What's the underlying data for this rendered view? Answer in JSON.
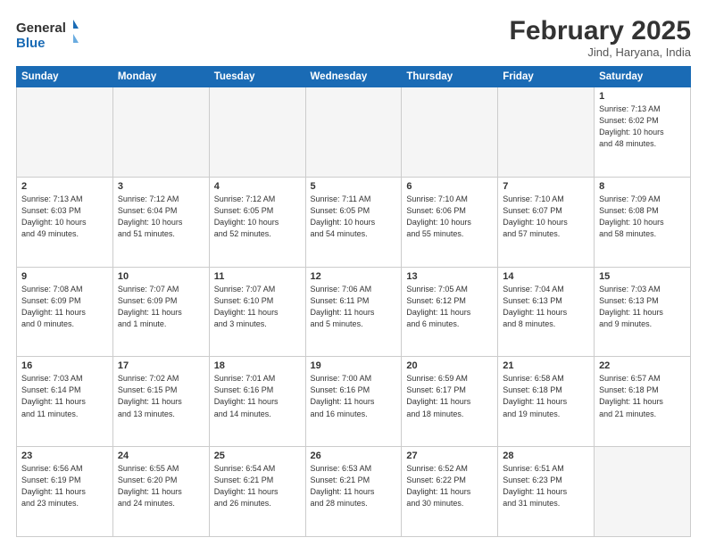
{
  "header": {
    "logo_general": "General",
    "logo_blue": "Blue",
    "month_title": "February 2025",
    "location": "Jind, Haryana, India"
  },
  "days_of_week": [
    "Sunday",
    "Monday",
    "Tuesday",
    "Wednesday",
    "Thursday",
    "Friday",
    "Saturday"
  ],
  "weeks": [
    [
      {
        "day": "",
        "info": ""
      },
      {
        "day": "",
        "info": ""
      },
      {
        "day": "",
        "info": ""
      },
      {
        "day": "",
        "info": ""
      },
      {
        "day": "",
        "info": ""
      },
      {
        "day": "",
        "info": ""
      },
      {
        "day": "1",
        "info": "Sunrise: 7:13 AM\nSunset: 6:02 PM\nDaylight: 10 hours\nand 48 minutes."
      }
    ],
    [
      {
        "day": "2",
        "info": "Sunrise: 7:13 AM\nSunset: 6:03 PM\nDaylight: 10 hours\nand 49 minutes."
      },
      {
        "day": "3",
        "info": "Sunrise: 7:12 AM\nSunset: 6:04 PM\nDaylight: 10 hours\nand 51 minutes."
      },
      {
        "day": "4",
        "info": "Sunrise: 7:12 AM\nSunset: 6:05 PM\nDaylight: 10 hours\nand 52 minutes."
      },
      {
        "day": "5",
        "info": "Sunrise: 7:11 AM\nSunset: 6:05 PM\nDaylight: 10 hours\nand 54 minutes."
      },
      {
        "day": "6",
        "info": "Sunrise: 7:10 AM\nSunset: 6:06 PM\nDaylight: 10 hours\nand 55 minutes."
      },
      {
        "day": "7",
        "info": "Sunrise: 7:10 AM\nSunset: 6:07 PM\nDaylight: 10 hours\nand 57 minutes."
      },
      {
        "day": "8",
        "info": "Sunrise: 7:09 AM\nSunset: 6:08 PM\nDaylight: 10 hours\nand 58 minutes."
      }
    ],
    [
      {
        "day": "9",
        "info": "Sunrise: 7:08 AM\nSunset: 6:09 PM\nDaylight: 11 hours\nand 0 minutes."
      },
      {
        "day": "10",
        "info": "Sunrise: 7:07 AM\nSunset: 6:09 PM\nDaylight: 11 hours\nand 1 minute."
      },
      {
        "day": "11",
        "info": "Sunrise: 7:07 AM\nSunset: 6:10 PM\nDaylight: 11 hours\nand 3 minutes."
      },
      {
        "day": "12",
        "info": "Sunrise: 7:06 AM\nSunset: 6:11 PM\nDaylight: 11 hours\nand 5 minutes."
      },
      {
        "day": "13",
        "info": "Sunrise: 7:05 AM\nSunset: 6:12 PM\nDaylight: 11 hours\nand 6 minutes."
      },
      {
        "day": "14",
        "info": "Sunrise: 7:04 AM\nSunset: 6:13 PM\nDaylight: 11 hours\nand 8 minutes."
      },
      {
        "day": "15",
        "info": "Sunrise: 7:03 AM\nSunset: 6:13 PM\nDaylight: 11 hours\nand 9 minutes."
      }
    ],
    [
      {
        "day": "16",
        "info": "Sunrise: 7:03 AM\nSunset: 6:14 PM\nDaylight: 11 hours\nand 11 minutes."
      },
      {
        "day": "17",
        "info": "Sunrise: 7:02 AM\nSunset: 6:15 PM\nDaylight: 11 hours\nand 13 minutes."
      },
      {
        "day": "18",
        "info": "Sunrise: 7:01 AM\nSunset: 6:16 PM\nDaylight: 11 hours\nand 14 minutes."
      },
      {
        "day": "19",
        "info": "Sunrise: 7:00 AM\nSunset: 6:16 PM\nDaylight: 11 hours\nand 16 minutes."
      },
      {
        "day": "20",
        "info": "Sunrise: 6:59 AM\nSunset: 6:17 PM\nDaylight: 11 hours\nand 18 minutes."
      },
      {
        "day": "21",
        "info": "Sunrise: 6:58 AM\nSunset: 6:18 PM\nDaylight: 11 hours\nand 19 minutes."
      },
      {
        "day": "22",
        "info": "Sunrise: 6:57 AM\nSunset: 6:18 PM\nDaylight: 11 hours\nand 21 minutes."
      }
    ],
    [
      {
        "day": "23",
        "info": "Sunrise: 6:56 AM\nSunset: 6:19 PM\nDaylight: 11 hours\nand 23 minutes."
      },
      {
        "day": "24",
        "info": "Sunrise: 6:55 AM\nSunset: 6:20 PM\nDaylight: 11 hours\nand 24 minutes."
      },
      {
        "day": "25",
        "info": "Sunrise: 6:54 AM\nSunset: 6:21 PM\nDaylight: 11 hours\nand 26 minutes."
      },
      {
        "day": "26",
        "info": "Sunrise: 6:53 AM\nSunset: 6:21 PM\nDaylight: 11 hours\nand 28 minutes."
      },
      {
        "day": "27",
        "info": "Sunrise: 6:52 AM\nSunset: 6:22 PM\nDaylight: 11 hours\nand 30 minutes."
      },
      {
        "day": "28",
        "info": "Sunrise: 6:51 AM\nSunset: 6:23 PM\nDaylight: 11 hours\nand 31 minutes."
      },
      {
        "day": "",
        "info": ""
      }
    ]
  ]
}
